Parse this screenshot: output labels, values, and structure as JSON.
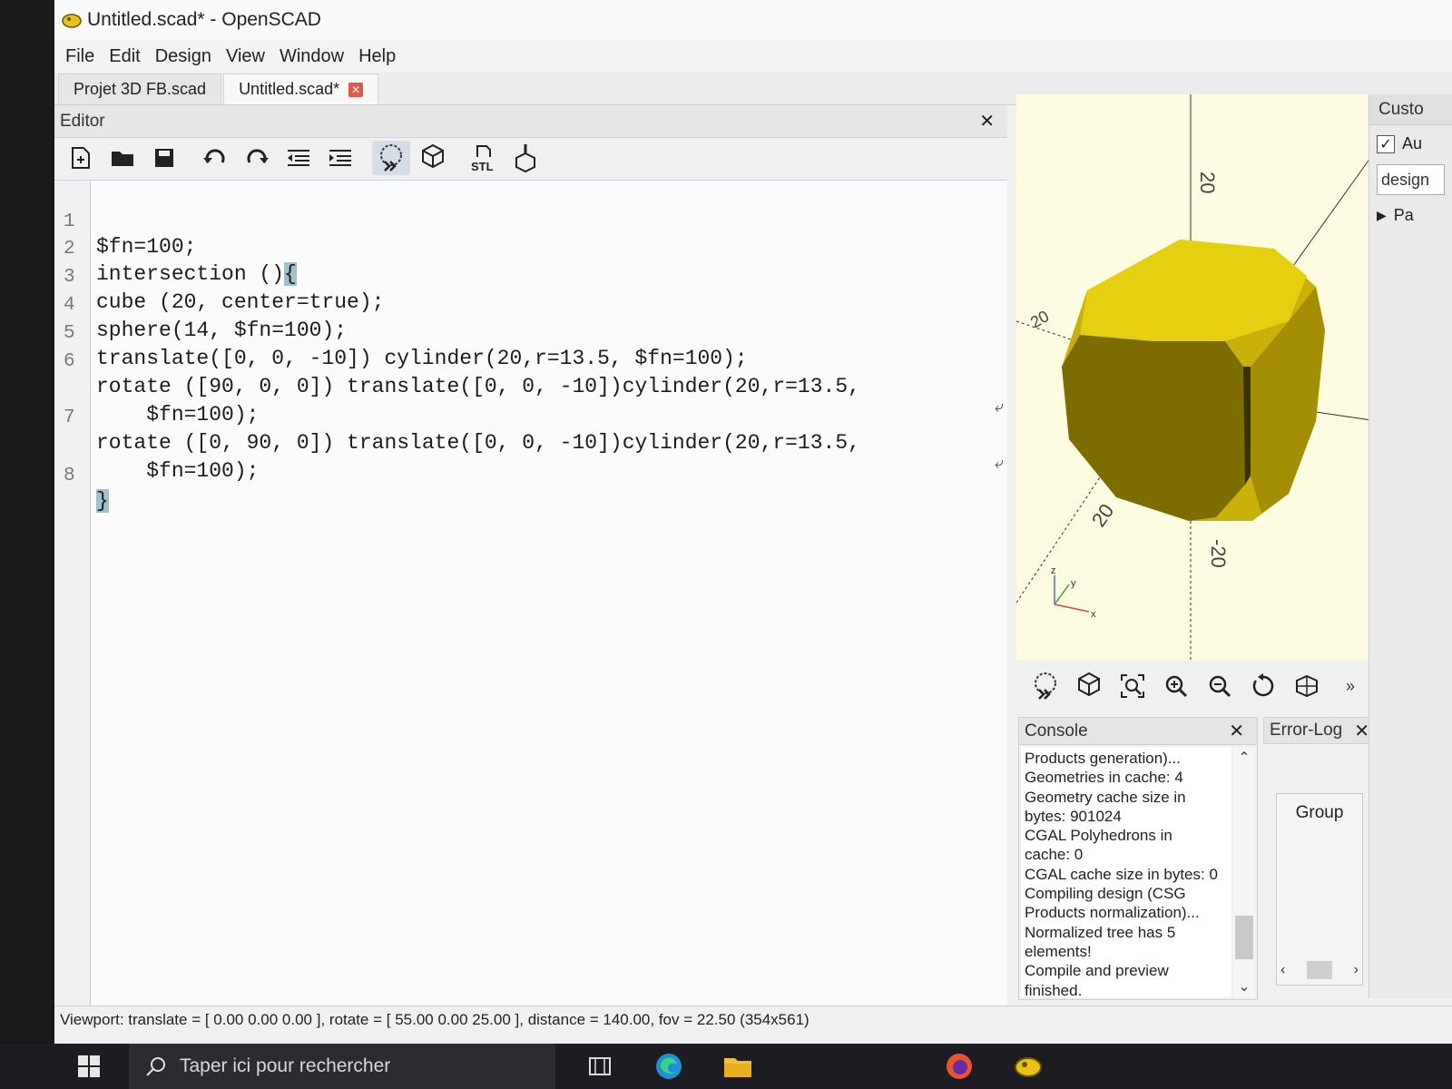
{
  "window": {
    "title": "Untitled.scad* - OpenSCAD"
  },
  "menu": [
    "File",
    "Edit",
    "Design",
    "View",
    "Window",
    "Help"
  ],
  "tabs": [
    {
      "label": "Projet 3D FB.scad"
    },
    {
      "label": "Untitled.scad*"
    }
  ],
  "editor": {
    "title": "Editor",
    "lines": [
      {
        "n": "1",
        "text": "$fn=100;"
      },
      {
        "n": "2",
        "text": "intersection ()"
      },
      {
        "n": "3",
        "text": "cube (20, center=true);"
      },
      {
        "n": "4",
        "text": "sphere(14, $fn=100);"
      },
      {
        "n": "5",
        "text": "translate([0, 0, -10]) cylinder(20,r=13.5, $fn=100);"
      },
      {
        "n": "6",
        "text": "rotate ([90, 0, 0]) translate([0, 0, -10])cylinder(20,r=13.5,"
      },
      {
        "n": "",
        "text": "    $fn=100);"
      },
      {
        "n": "7",
        "text": "rotate ([0, 90, 0]) translate([0, 0, -10])cylinder(20,r=13.5,"
      },
      {
        "n": "",
        "text": "    $fn=100);"
      },
      {
        "n": "8",
        "text": ""
      }
    ],
    "open_brace": "{",
    "close_brace": "}",
    "toolbar_icons": [
      "new-file",
      "open-folder",
      "save",
      "undo",
      "redo",
      "unindent",
      "indent",
      "preview",
      "render",
      "export-stl",
      "send-to-print"
    ]
  },
  "viewport": {
    "axis_labels": [
      "20",
      "20",
      "20",
      "-20"
    ],
    "gizmo": {
      "z": "z",
      "y": "y",
      "x": "x"
    },
    "model_color": "#e6cf10",
    "background": "#fdfbe0"
  },
  "viewport_toolbar": [
    "preview",
    "render",
    "view-all",
    "zoom-in",
    "zoom-out",
    "reset-view",
    "perspective",
    "more"
  ],
  "console": {
    "title": "Console",
    "lines": [
      "Products generation)...",
      "Geometries in cache: 4",
      "Geometry cache size in",
      "bytes: 901024",
      "CGAL Polyhedrons in",
      "cache: 0",
      "CGAL cache size in bytes: 0",
      "Compiling design (CSG",
      "Products normalization)...",
      "Normalized tree has 5",
      "elements!",
      "Compile and preview",
      "finished."
    ]
  },
  "error_log": {
    "title": "Error-Log",
    "group_label": "Group"
  },
  "customizer": {
    "title": "Custo",
    "auto_label": "Au",
    "design_value": "design",
    "params_label": "Pa"
  },
  "status": {
    "text": "Viewport: translate = [ 0.00 0.00 0.00 ], rotate = [ 55.00 0.00 25.00 ], distance = 140.00, fov = 22.50 (354x561)"
  },
  "taskbar": {
    "search_placeholder": "Taper ici pour rechercher"
  }
}
